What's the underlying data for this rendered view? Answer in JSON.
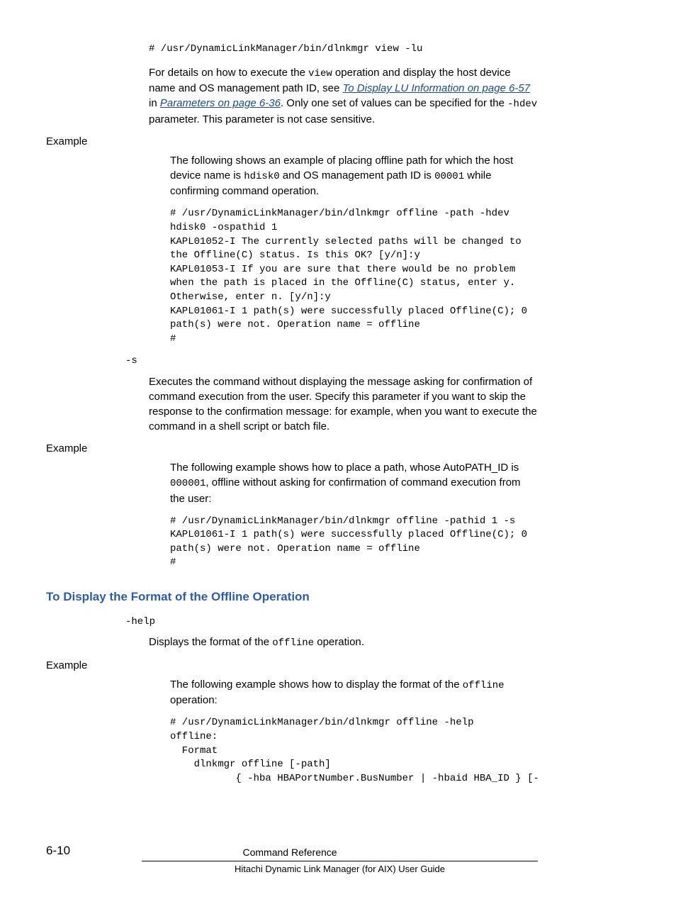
{
  "cmd_view": "# /usr/DynamicLinkManager/bin/dlnkmgr view -lu",
  "para1a": "For details on how to execute the ",
  "para1_view": "view",
  "para1b": " operation and display the host device name and OS management path ID, see ",
  "link1": "To Display LU Information on page 6-57",
  "para1c": " in ",
  "link2": "Parameters on page 6-36",
  "para1d": ". Only one set of values can be specified for the ",
  "para1_hdev": "-hdev",
  "para1e": " parameter. This parameter is not case sensitive.",
  "example_label": "Example",
  "ex1a": "The following shows an example of placing offline path for which the host device name is ",
  "ex1_hdisk": "hdisk0",
  "ex1b": " and OS management path ID is ",
  "ex1_pathid": "00001",
  "ex1c": " while confirming command operation.",
  "code1": "# /usr/DynamicLinkManager/bin/dlnkmgr offline -path -hdev\nhdisk0 -ospathid 1\nKAPL01052-I The currently selected paths will be changed to\nthe Offline(C) status. Is this OK? [y/n]:y\nKAPL01053-I If you are sure that there would be no problem\nwhen the path is placed in the Offline(C) status, enter y.\nOtherwise, enter n. [y/n]:y\nKAPL01061-I 1 path(s) were successfully placed Offline(C); 0\npath(s) were not. Operation name = offline\n#",
  "param_s": "-s",
  "s_desc": "Executes the command without displaying the message asking for confirmation of command execution from the user. Specify this parameter if you want to skip the response to the confirmation message: for example, when you want to execute the command in a shell script or batch file.",
  "ex2a": "The following example shows how to place a path, whose AutoPATH_ID is ",
  "ex2_pathid": "000001",
  "ex2b": ", offline without asking for confirmation of command execution from the user:",
  "code2": "# /usr/DynamicLinkManager/bin/dlnkmgr offline -pathid 1 -s\nKAPL01061-I 1 path(s) were successfully placed Offline(C); 0\npath(s) were not. Operation name = offline\n#",
  "section_heading": "To Display the Format of the Offline Operation",
  "param_help": "-help",
  "help_desc_a": "Displays the format of the ",
  "help_offline": "offline",
  "help_desc_b": " operation.",
  "ex3a": "The following example shows how to display the format of the ",
  "ex3_offline": "offline",
  "ex3b": " operation:",
  "code3": "# /usr/DynamicLinkManager/bin/dlnkmgr offline -help\noffline:\n  Format\n    dlnkmgr offline [-path]\n           { -hba HBAPortNumber.BusNumber | -hbaid HBA_ID } [-",
  "footer_page": "6-10",
  "footer_title": "Command Reference",
  "footer_sub": "Hitachi Dynamic Link Manager (for AIX) User Guide"
}
